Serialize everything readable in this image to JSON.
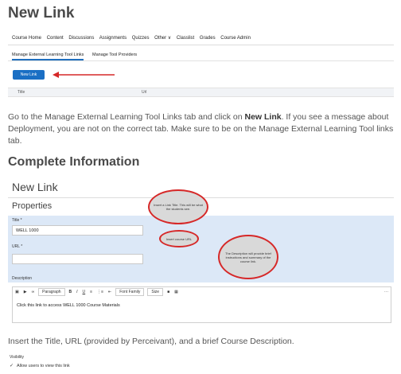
{
  "page": {
    "title": "New Link",
    "paragraph1": {
      "before": "Go to the Manage External Learning Tool Links tab and click on ",
      "bold": "New Link",
      "after": ". If you see a message about Deployment, you are not on the correct tab. Make sure to be on the Manage External Learning Tool links tab."
    },
    "section_title": "Complete Information",
    "paragraph2": "Insert the Title, URL (provided by Perceivant), and a brief Course Description."
  },
  "shot1": {
    "nav_items": [
      "Course Home",
      "Content",
      "Discussions",
      "Assignments",
      "Quizzes",
      "Other ∨",
      "Classlist",
      "Grades",
      "Course Admin"
    ],
    "tabs": [
      "Manage External Learning Tool Links",
      "Manage Tool Providers"
    ],
    "new_link_button": "New Link",
    "col_title": "Title",
    "col_url": "Url",
    "arrow_color": "#d62828"
  },
  "shot2": {
    "heading": "New Link",
    "properties": "Properties",
    "title_label": "Title *",
    "title_value": "WELL 1000",
    "url_label": "URL *",
    "description_label": "Description",
    "toolbar": {
      "paragraph": "Paragraph",
      "font_family": "Font Family",
      "size": "Size",
      "more": "···"
    },
    "editor_text": "Click this link to access WELL 1000 Course Materials",
    "bubble1": "Insert a Link Title. This will be what the students see.",
    "bubble2": "Insert course URL",
    "bubble3": "The Description will provide brief instructions and summary of the course link.",
    "band_color": "#dce8f7"
  },
  "visibility": {
    "label": "Visibility",
    "allow": "Allow users to view this link"
  }
}
